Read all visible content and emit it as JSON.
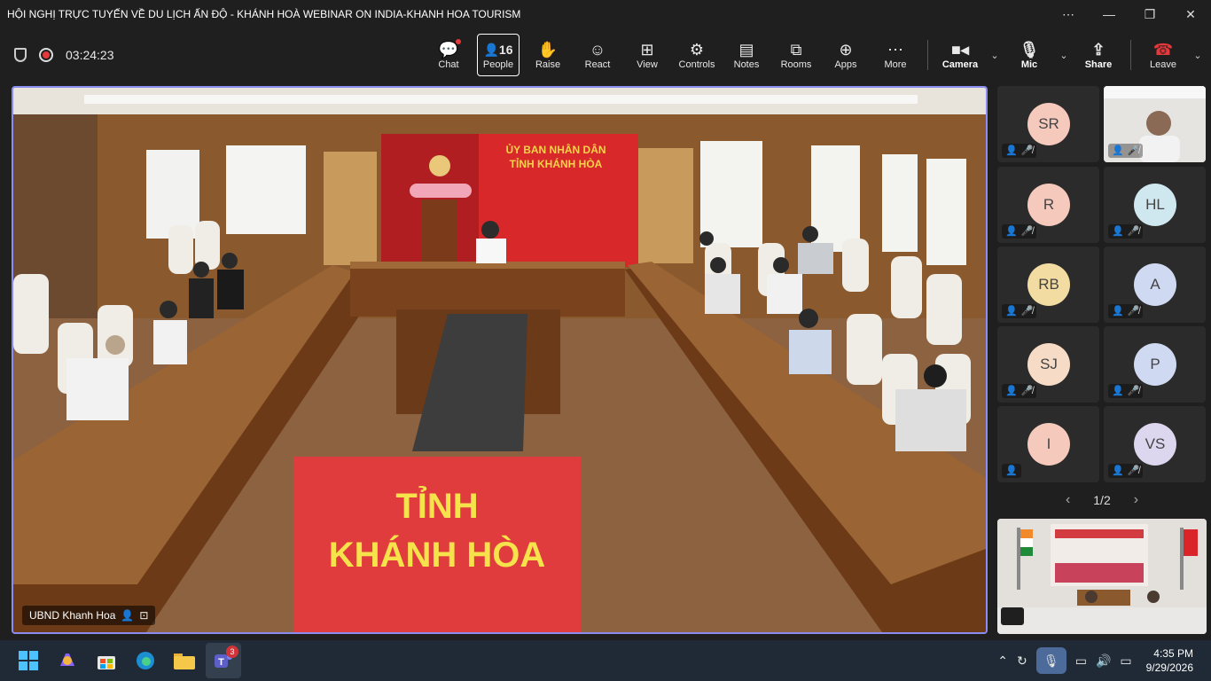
{
  "window": {
    "title": "HỘI NGHỊ TRỰC TUYẾN VỀ DU LỊCH ẤN ĐỘ - KHÁNH HOÀ WEBINAR ON INDIA-KHANH HOA TOURISM",
    "more_icon": "⋯",
    "minimize_icon": "—",
    "restore_icon": "❐",
    "close_icon": "✕"
  },
  "meeting": {
    "timer": "03:24:23"
  },
  "toolbar": {
    "chat_label": "Chat",
    "people_label": "People",
    "people_count": "16",
    "raise_label": "Raise",
    "react_label": "React",
    "view_label": "View",
    "controls_label": "Controls",
    "notes_label": "Notes",
    "rooms_label": "Rooms",
    "apps_label": "Apps",
    "more_label": "More",
    "camera_label": "Camera",
    "mic_label": "Mic",
    "share_label": "Share",
    "leave_label": "Leave"
  },
  "stage": {
    "participant_name": "UBND Khanh Hoa",
    "banner_line1": "ỦY BAN NHÂN DÂN",
    "banner_line2": "TỈNH KHÁNH HÒA",
    "sign_line1": "TỈNH",
    "sign_line2": "KHÁNH HÒA"
  },
  "gallery": {
    "tiles": [
      {
        "initials": "SR",
        "color": "#f6c9bd"
      },
      {
        "initials": "",
        "color": "#cfd8dc"
      },
      {
        "initials": "R",
        "color": "#f6c9bd"
      },
      {
        "initials": "HL",
        "color": "#cfe7ef"
      },
      {
        "initials": "RB",
        "color": "#f2dca1"
      },
      {
        "initials": "A",
        "color": "#cfd9f1"
      },
      {
        "initials": "SJ",
        "color": "#f6dcc6"
      },
      {
        "initials": "P",
        "color": "#cfd9f1"
      },
      {
        "initials": "I",
        "color": "#f6c9bd"
      },
      {
        "initials": "VS",
        "color": "#ddd6ef"
      }
    ],
    "page": "1/2"
  },
  "taskbar": {
    "teams_badge": "3",
    "time": "4:35 PM",
    "date": "9/29/2026"
  },
  "colors": {
    "accent": "#8b8cf0",
    "leave": "#e5383b"
  }
}
